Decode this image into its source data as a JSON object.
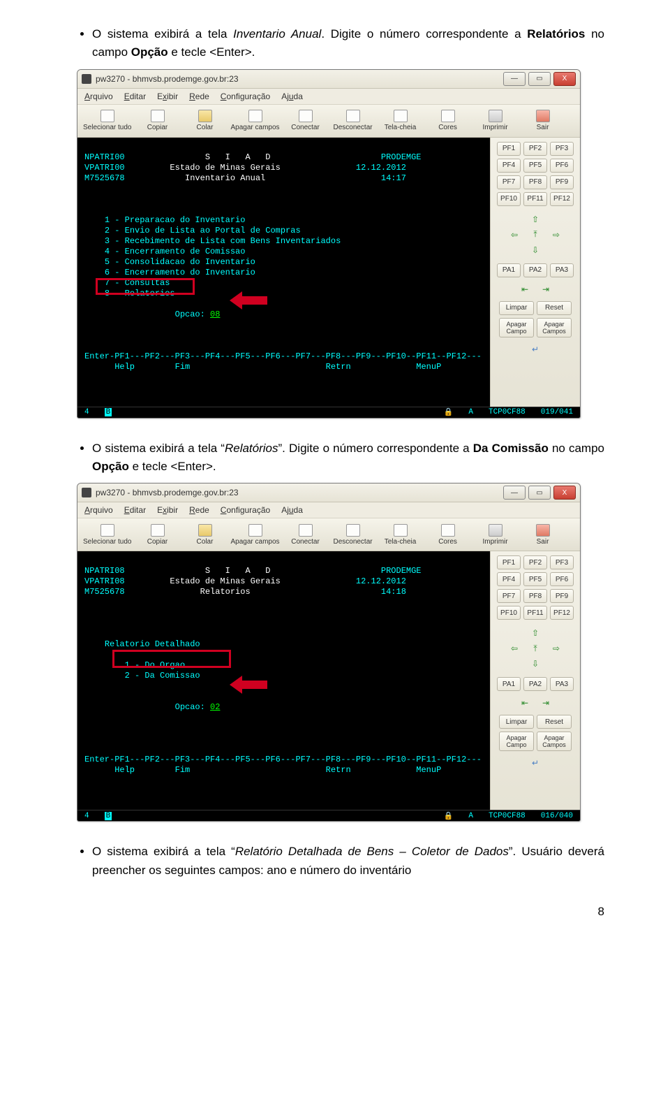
{
  "doc": {
    "para1_pre": "O sistema exibirá a tela ",
    "para1_ital": "Inventario Anual",
    "para1_post": ". Digite o número correspondente a ",
    "para1_bold": "Relatórios",
    "para1_tail": " no campo ",
    "para1_bold2": "Opção",
    "para1_end": " e tecle <Enter>.",
    "para2_pre": "O sistema exibirá a tela “",
    "para2_ital": "Relatórios",
    "para2_post": "”. Digite o número correspondente a ",
    "para2_bold": "Da Comissão",
    "para2_tail": " no campo ",
    "para2_bold2": "Opção",
    "para2_end": " e tecle <Enter>.",
    "para3_pre": "O sistema exibirá a tela “",
    "para3_ital": "Relatório Detalhada de Bens – Coletor de Dados",
    "para3_post": "”. Usuário deverá preencher os seguintes campos: ano e número do inventário",
    "page_number": "8"
  },
  "window": {
    "title": "pw3270 - bhmvsb.prodemge.gov.br:23",
    "min": "—",
    "max": "▭",
    "close": "X"
  },
  "menu": {
    "arquivo": "Arquivo",
    "editar": "Editar",
    "exibir": "Exibir",
    "rede": "Rede",
    "config": "Configuração",
    "ajuda": "Ajuda"
  },
  "tb": {
    "sel": "Selecionar tudo",
    "cop": "Copiar",
    "col": "Colar",
    "apg": "Apagar campos",
    "con": "Conectar",
    "des": "Desconectar",
    "tel": "Tela-cheia",
    "cor": "Cores",
    "imp": "Imprimir",
    "sai": "Sair"
  },
  "keys": {
    "pf1": "PF1",
    "pf2": "PF2",
    "pf3": "PF3",
    "pf4": "PF4",
    "pf5": "PF5",
    "pf6": "PF6",
    "pf7": "PF7",
    "pf8": "PF8",
    "pf9": "PF9",
    "pf10": "PF10",
    "pf11": "PF11",
    "pf12": "PF12",
    "pa1": "PA1",
    "pa2": "PA2",
    "pa3": "PA3",
    "limp": "Limpar",
    "reset": "Reset",
    "apc": "Apagar Campo",
    "apcs": "Apagar Campos"
  },
  "term1": {
    "l1a": "NPATRI00",
    "l1b": "S   I   A   D",
    "l1c": "PRODEMGE",
    "l2a": "VPATRI00",
    "l2b": "Estado de Minas Gerais",
    "l2c": "12.12.2012",
    "l3a": "M7525678",
    "l3b": "Inventario Anual",
    "l3c": "14:17",
    "m1": "1 - Preparacao do Inventario",
    "m2": "2 - Envio de Lista ao Portal de Compras",
    "m3": "3 - Recebimento de Lista com Bens Inventariados",
    "m4": "4 - Encerramento de Comissao",
    "m5": "5 - Consolidacao do Inventario",
    "m6": "6 - Encerramento do Inventario",
    "m7": "7 - Consultas",
    "m8": "8 - Relatorios",
    "opc_lbl": "Opcao: ",
    "opc_val": "08",
    "f": "Enter-PF1---PF2---PF3---PF4---PF5---PF6---PF7---PF8---PF9---PF10--PF11--PF12---",
    "fb": "      Help        Fim                           Retrn             MenuP",
    "status_l": "4",
    "status_b": "B",
    "status_a": "A",
    "status_tcp": "TCP0CF88",
    "status_pos": "019/041"
  },
  "term2": {
    "l1a": "NPATRI08",
    "l1b": "S   I   A   D",
    "l1c": "PRODEMGE",
    "l2a": "VPATRI08",
    "l2b": "Estado de Minas Gerais",
    "l2c": "12.12.2012",
    "l3a": "M7525678",
    "l3b": "Relatorios",
    "l3c": "14:18",
    "sect": "Relatorio Detalhado",
    "m1": "1 - Do Orgao",
    "m2": "2 - Da Comissao",
    "opc_lbl": "Opcao: ",
    "opc_val": "02",
    "f": "Enter-PF1---PF2---PF3---PF4---PF5---PF6---PF7---PF8---PF9---PF10--PF11--PF12---",
    "fb": "      Help        Fim                           Retrn             MenuP",
    "status_l": "4",
    "status_b": "B",
    "status_a": "A",
    "status_tcp": "TCP0CF88",
    "status_pos": "016/040"
  }
}
